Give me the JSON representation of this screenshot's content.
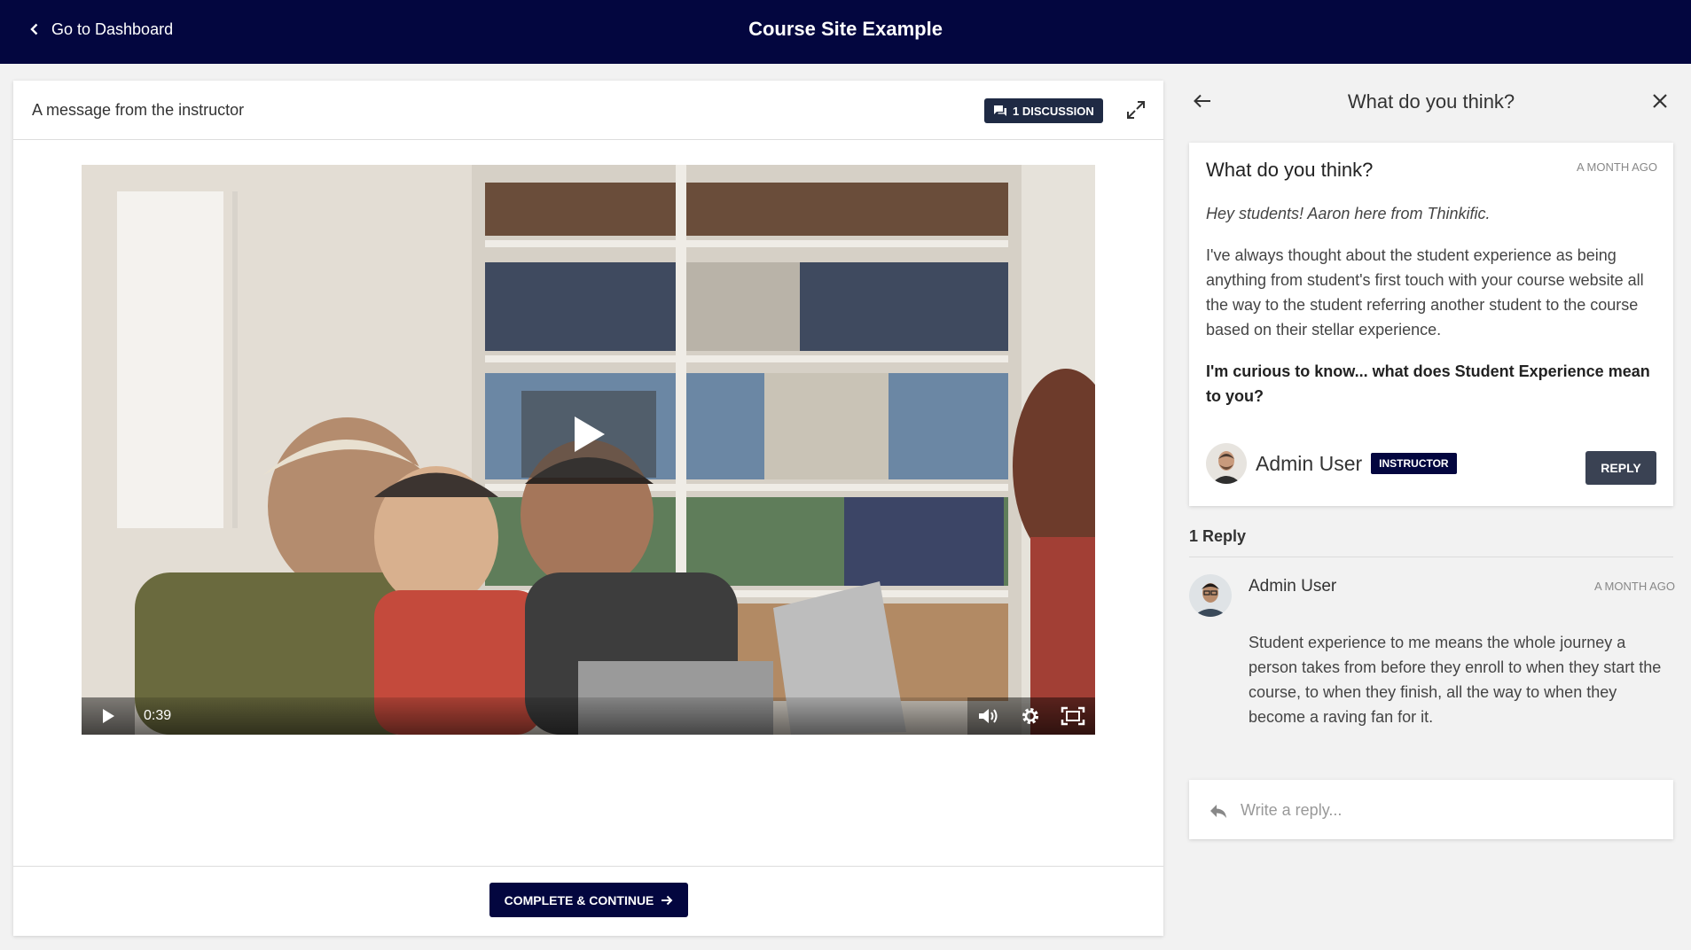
{
  "topbar": {
    "back_label": "Go to Dashboard",
    "site_title": "Course Site Example"
  },
  "lesson": {
    "title": "A message from the instructor",
    "discussion_badge": "1 DISCUSSION",
    "video": {
      "current_time": "0:39",
      "icons": [
        "play-icon",
        "volume-icon",
        "settings-gear-icon",
        "fullscreen-icon"
      ]
    },
    "complete_label": "COMPLETE & CONTINUE"
  },
  "discussion": {
    "panel_title": "What do you think?",
    "post": {
      "title": "What do you think?",
      "time": "A MONTH AGO",
      "intro": "Hey students! Aaron here from Thinkific.",
      "body": "I've always thought about the student experience as being anything from student's first touch with your course website all the way to the student referring another student to the course based on their stellar experience.",
      "question": "I'm curious to know... what does Student Experience mean to you?",
      "author": "Admin User",
      "role": "INSTRUCTOR",
      "reply_label": "REPLY"
    },
    "reply_count": "1 Reply",
    "replies": [
      {
        "author": "Admin User",
        "time": "A MONTH AGO",
        "text": "Student experience to me means the whole journey a person takes from before they enroll to when they start the course, to when they finish, all the way to when they become a raving fan for it."
      }
    ],
    "reply_placeholder": "Write a reply..."
  },
  "colors": {
    "brand_navy": "#03063f",
    "badge_dark": "#1f2a44",
    "reply_button": "#3a4253",
    "page_background": "#f2f2f2"
  }
}
